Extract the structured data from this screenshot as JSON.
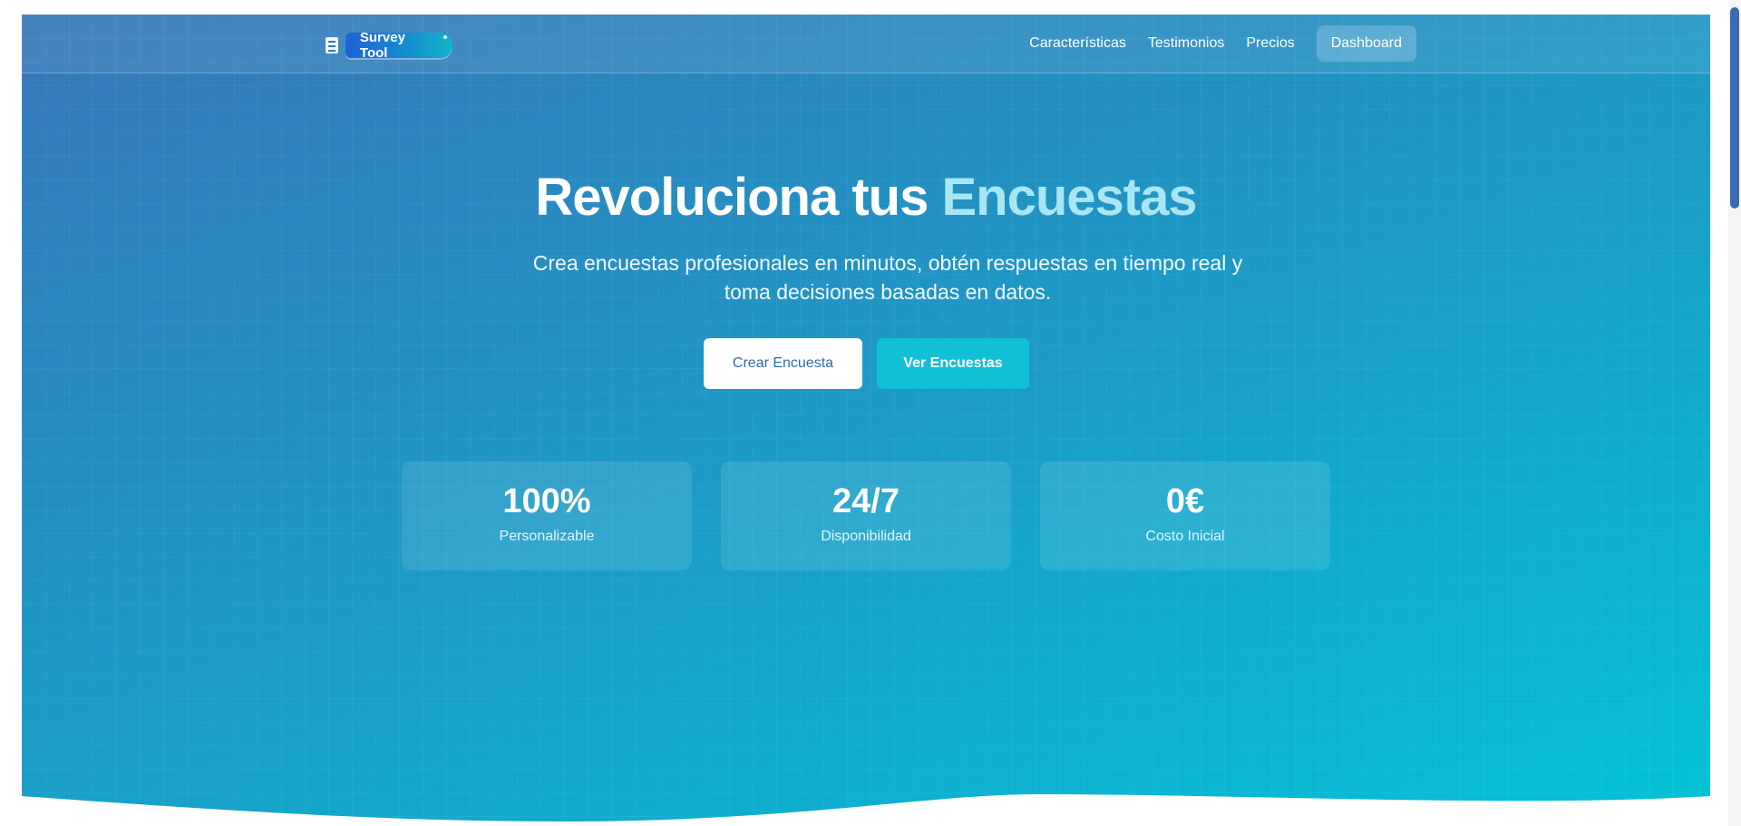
{
  "brand": {
    "name": "Survey Tool"
  },
  "nav": {
    "links": [
      "Características",
      "Testimonios",
      "Precios"
    ],
    "dashboard": "Dashboard"
  },
  "hero": {
    "title_main": "Revoluciona tus ",
    "title_accent": "Encuestas",
    "subtitle": "Crea encuestas profesionales en minutos, obtén respuestas en tiempo real y toma decisiones basadas en datos.",
    "primary_button": "Crear Encuesta",
    "secondary_button": "Ver Encuestas"
  },
  "stats": [
    {
      "value": "100%",
      "label": "Personalizable"
    },
    {
      "value": "24/7",
      "label": "Disponibilidad"
    },
    {
      "value": "0€",
      "label": "Costo Inicial"
    }
  ],
  "colors": {
    "gradient_start": "#3877ba",
    "gradient_end": "#03c2d6",
    "accent": "#a8e6f4",
    "secondary_button": "#12c0d6"
  },
  "icons": {
    "logo": "document-icon"
  }
}
